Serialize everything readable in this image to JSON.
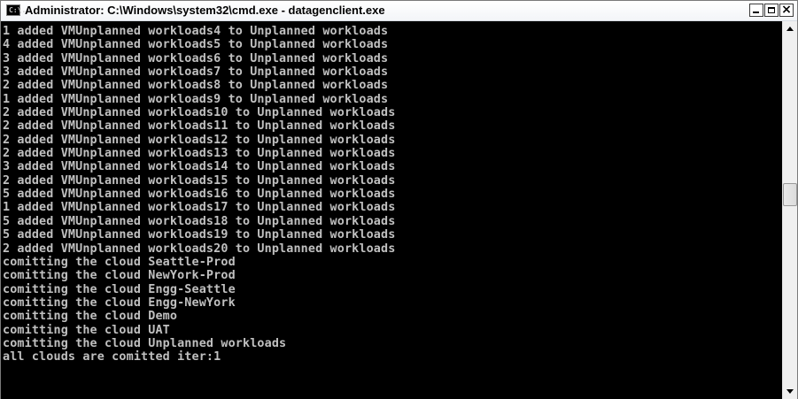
{
  "window": {
    "title": "Administrator: C:\\Windows\\system32\\cmd.exe - datagenclient.exe",
    "icon_label": "C:\\.",
    "buttons": [
      "minimize-icon",
      "maximize-icon",
      "close-icon"
    ],
    "close_glyph": "×"
  },
  "console": {
    "background": "#000000",
    "text_color": "#c0c0c0",
    "lines": [
      "1 added VMUnplanned workloads4 to Unplanned workloads",
      "4 added VMUnplanned workloads5 to Unplanned workloads",
      "3 added VMUnplanned workloads6 to Unplanned workloads",
      "3 added VMUnplanned workloads7 to Unplanned workloads",
      "2 added VMUnplanned workloads8 to Unplanned workloads",
      "1 added VMUnplanned workloads9 to Unplanned workloads",
      "2 added VMUnplanned workloads10 to Unplanned workloads",
      "2 added VMUnplanned workloads11 to Unplanned workloads",
      "2 added VMUnplanned workloads12 to Unplanned workloads",
      "2 added VMUnplanned workloads13 to Unplanned workloads",
      "3 added VMUnplanned workloads14 to Unplanned workloads",
      "2 added VMUnplanned workloads15 to Unplanned workloads",
      "5 added VMUnplanned workloads16 to Unplanned workloads",
      "1 added VMUnplanned workloads17 to Unplanned workloads",
      "5 added VMUnplanned workloads18 to Unplanned workloads",
      "5 added VMUnplanned workloads19 to Unplanned workloads",
      "2 added VMUnplanned workloads20 to Unplanned workloads",
      "comitting the cloud Seattle-Prod",
      "comitting the cloud NewYork-Prod",
      "comitting the cloud Engg-Seattle",
      "comitting the cloud Engg-NewYork",
      "comitting the cloud Demo",
      "comitting the cloud UAT",
      "comitting the cloud Unplanned workloads",
      "all clouds are comitted iter:1"
    ]
  },
  "scrollbar": {
    "up_icon": "arrow-up-icon",
    "down_icon": "arrow-down-icon"
  }
}
